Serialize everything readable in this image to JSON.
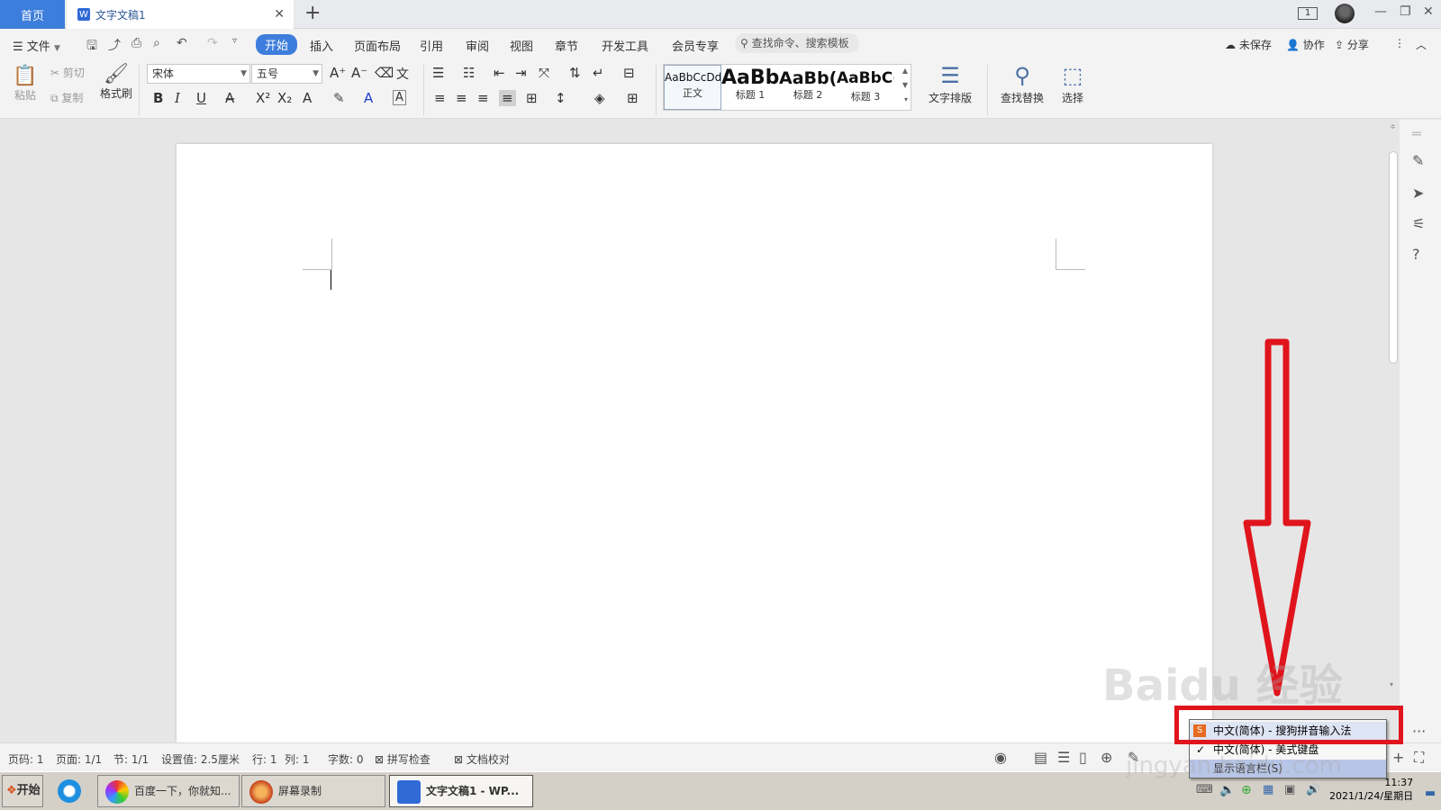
{
  "tabs": {
    "home_label": "首页",
    "doc_label": "文字文稿1",
    "doc_icon": "W",
    "add": "+",
    "screen_count": "1"
  },
  "window": {
    "minimize": "—",
    "restore": "❐",
    "close": "✕"
  },
  "menubar": {
    "file": "文件",
    "items": [
      "开始",
      "插入",
      "页面布局",
      "引用",
      "审阅",
      "视图",
      "章节",
      "开发工具",
      "会员专享"
    ],
    "search_placeholder": "查找命令、搜索模板",
    "unsaved": "未保存",
    "collab": "协作",
    "share": "分享"
  },
  "ribbon": {
    "paste": "粘贴",
    "cut": "剪切",
    "copy": "复制",
    "format_painter": "格式刷",
    "font_name": "宋体",
    "font_size": "五号",
    "styles": [
      {
        "sample": "AaBbCcDd",
        "name": "正文"
      },
      {
        "sample": "AaBb",
        "name": "标题 1"
      },
      {
        "sample": "AaBb(",
        "name": "标题 2"
      },
      {
        "sample": "AaBbC(",
        "name": "标题 3"
      }
    ],
    "text_layout": "文字排版",
    "find_replace": "查找替换",
    "select": "选择"
  },
  "statusbar": {
    "page_code": "页码: 1",
    "page": "页面: 1/1",
    "section": "节: 1/1",
    "setting": "设置值: 2.5厘米",
    "row": "行: 1",
    "col": "列: 1",
    "words": "字数: 0",
    "spell_check": "拼写检查",
    "doc_proof": "文档校对"
  },
  "taskbar": {
    "start": "开始",
    "baidu": "百度一下，你就知...",
    "recorder": "屏幕录制",
    "wps": "文字文稿1 - WP...",
    "time": "11:37",
    "date": "2021/1/24/星期日"
  },
  "popup": {
    "item1": "中文(简体) - 搜狗拼音输入法",
    "item2": "中文(简体) - 美式键盘",
    "footer": "显示语言栏(S)"
  },
  "watermark": {
    "text": "Baidu 经验",
    "url": "jingyan.baidu.com"
  },
  "colors": {
    "accent": "#3d7ddb",
    "annotation_red": "#e0141c"
  }
}
